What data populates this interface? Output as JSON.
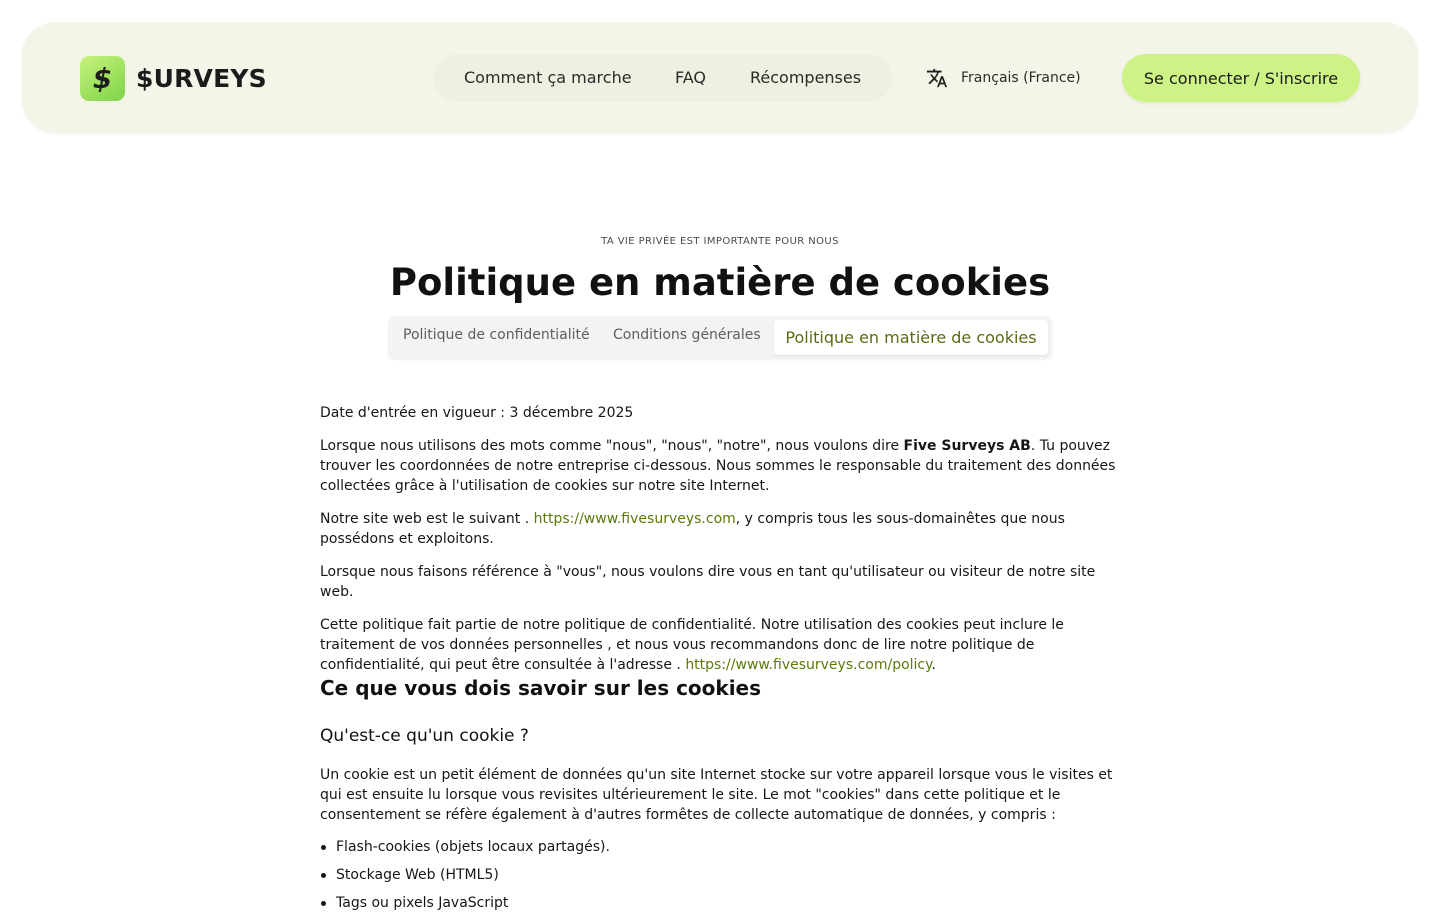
{
  "header": {
    "logo_text": "$URVEYS",
    "logo_mark": "$",
    "nav": [
      {
        "label": "Comment ça marche"
      },
      {
        "label": "FAQ"
      },
      {
        "label": "Récompenses"
      }
    ],
    "language": "Français (France)",
    "language_icon": "translate-icon",
    "cta_label": "Se connecter / S'inscrire"
  },
  "hero": {
    "eyebrow": "TA VIE PRIVÉE EST IMPORTANTE POUR NOUS",
    "title": "Politique en matière de cookies",
    "tabs": [
      {
        "label": "Politique de confidentialité",
        "active": false
      },
      {
        "label": "Conditions générales",
        "active": false
      },
      {
        "label": "Politique en matière de cookies",
        "active": true
      }
    ]
  },
  "content": {
    "effective_date": "Date d'entrée en vigueur : 3 décembre 2025",
    "p1_before": "Lorsque nous utilisons des mots comme \"nous\", \"nous\", \"notre\", nous voulons dire ",
    "p1_bold": "Five Surveys AB",
    "p1_after": ". Tu pouvez trouver les coordonnées de notre entreprise ci-dessous. Nous sommes le responsable du traitement des données collectées grâce à l'utilisation de cookies sur notre site Internet.",
    "p2_before": "Notre site web est le suivant . ",
    "p2_link": "https://www.fivesurveys.com",
    "p2_after": ", y compris tous les sous-domainêtes que nous possédons et exploitons.",
    "p3": "Lorsque nous faisons référence à \"vous\", nous voulons dire vous en tant qu'utilisateur ou visiteur de notre site web.",
    "p4_before": "Cette politique fait partie de notre politique de confidentialité. Notre utilisation des cookies peut inclure le traitement de vos données personnelles , et nous vous recommandons donc de lire notre politique de confidentialité, qui peut être consultée à l'adresse . ",
    "p4_link": "https://www.fivesurveys.com/policy",
    "p4_after": ".",
    "h2": "Ce que vous dois savoir sur les cookies",
    "h3": "Qu'est-ce qu'un cookie ?",
    "p5": "Un cookie est un petit élément de données qu'un site Internet stocke sur votre appareil lorsque vous le visites et qui est ensuite lu lorsque vous revisites ultérieurement le site. Le mot \"cookies\" dans cette politique et le consentement se réfère également à d'autres formêtes de collecte automatique de données, y compris :",
    "bullets": [
      "Flash-cookies (objets locaux partagés).",
      "Stockage Web (HTML5)",
      "Tags ou pixels JavaScript"
    ]
  }
}
